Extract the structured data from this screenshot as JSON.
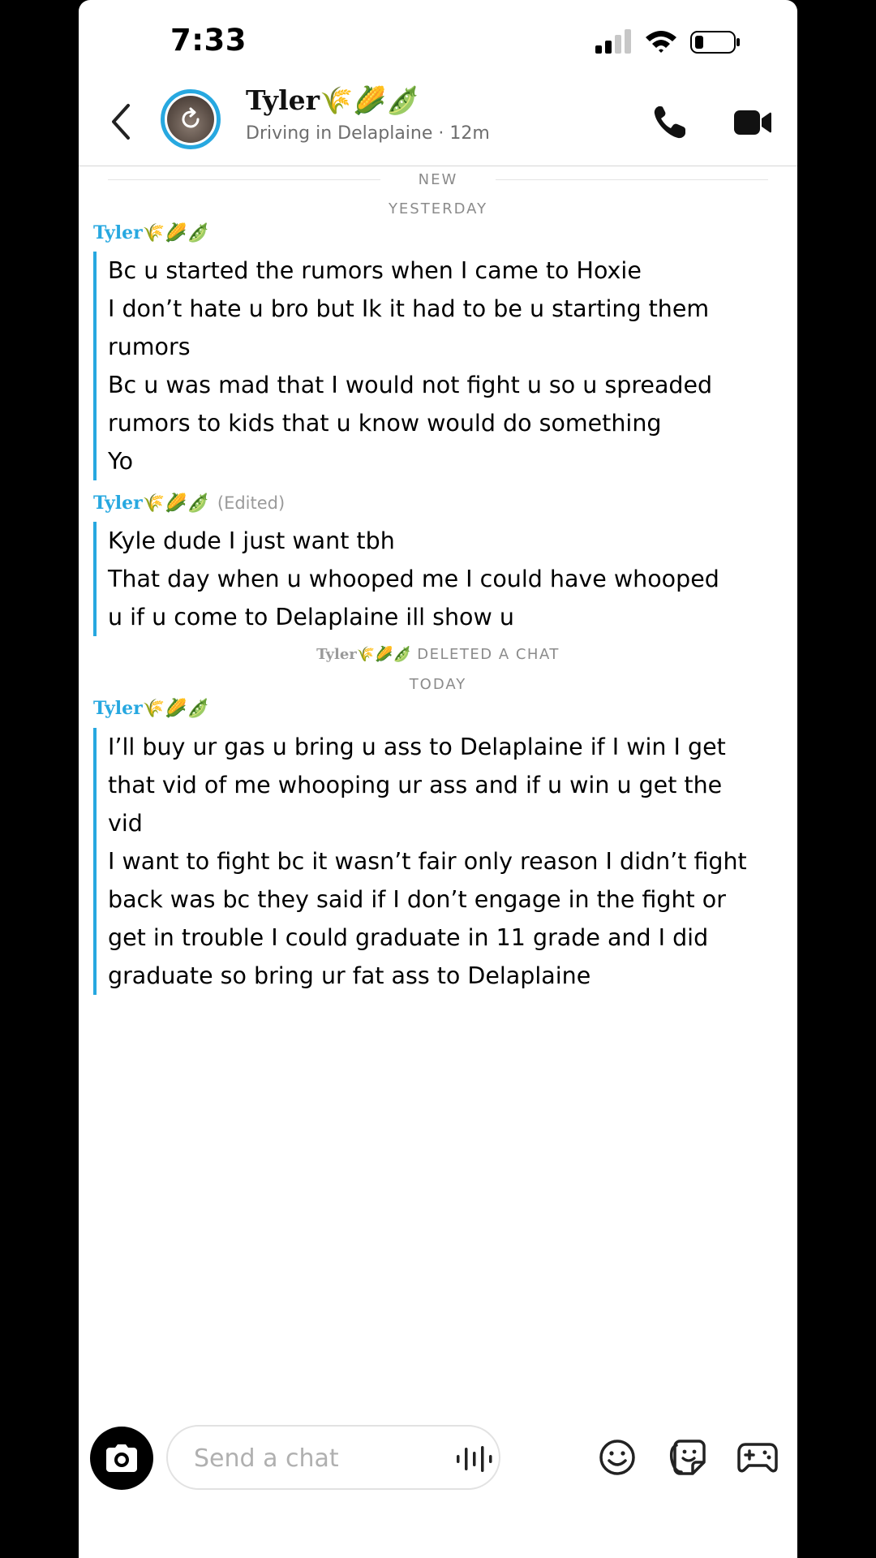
{
  "status_bar": {
    "time": "7:33"
  },
  "header": {
    "contact_name": "Tyler🌾🌽🫛",
    "contact_status": "Driving in Delaplaine · 12m"
  },
  "chat": {
    "new_label": "NEW",
    "yesterday_label": "YESTERDAY",
    "today_label": "TODAY",
    "groups": [
      {
        "sender": "Tyler🌾🌽🫛",
        "edited": "",
        "lines": [
          "Bc u started the rumors when I came to Hoxie",
          "I don’t hate u bro but Ik it had to be u starting them",
          "rumors",
          "Bc u was mad that I would not fight u so u spreaded",
          "rumors to kids that u know would do something",
          "Yo"
        ]
      },
      {
        "sender": "Tyler🌾🌽🫛",
        "edited": "(Edited)",
        "lines": [
          "Kyle dude I just want tbh",
          "That day when u whooped me I could have whooped",
          "u if u come to Delaplaine ill show u"
        ]
      },
      {
        "sender": "Tyler🌾🌽🫛",
        "edited": "",
        "lines": [
          "I’ll buy ur gas u bring u ass to Delaplaine if I win I get",
          "that vid of me whooping ur ass and if u win u get the",
          "vid",
          "I want to fight bc it wasn’t fair only reason I didn’t fight",
          "back was bc they said if I don’t engage in the fight or",
          "get in trouble I could graduate in 11 grade and I did",
          "graduate so bring ur fat ass to Delaplaine"
        ]
      }
    ],
    "deleted_note": {
      "who": "Tyler🌾🌽🫛",
      "text": "DELETED A CHAT"
    }
  },
  "composer": {
    "placeholder": "Send a chat"
  },
  "icons": {
    "back": "chevron-left-icon",
    "call": "phone-icon",
    "video": "video-camera-icon",
    "camera": "camera-icon",
    "voice": "voice-waveform-icon",
    "emoji": "smiley-icon",
    "sticker": "sticker-icon",
    "game": "gamepad-icon"
  },
  "colors": {
    "accent": "#27a8e0",
    "text": "#000000",
    "muted": "#8b8b8b",
    "background": "#ffffff"
  }
}
